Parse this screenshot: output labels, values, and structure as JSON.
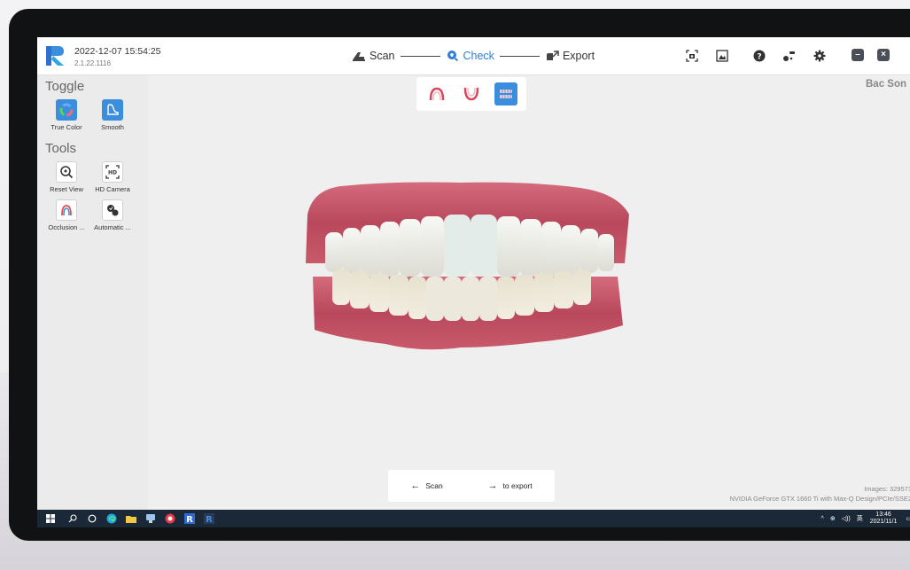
{
  "app": {
    "datetime": "2022-12-07 15:54:25",
    "version": "2.1.22.1116",
    "patient_name": "Bac Son"
  },
  "workflow": {
    "steps": [
      {
        "label": "Scan",
        "icon": "scanner-icon",
        "active": false
      },
      {
        "label": "Check",
        "icon": "magnifier-tooth-icon",
        "active": true
      },
      {
        "label": "Export",
        "icon": "export-icon",
        "active": false
      }
    ]
  },
  "toolbar_icons": [
    "screenshot-icon",
    "image-gallery-icon",
    "help-icon",
    "connect-device-icon",
    "settings-gear-icon"
  ],
  "sidebar": {
    "toggle_title": "Toggle",
    "toggle_items": [
      {
        "label": "True Color",
        "icon": "color-wheel-icon"
      },
      {
        "label": "Smooth",
        "icon": "smooth-icon"
      }
    ],
    "tools_title": "Tools",
    "tool_items": [
      {
        "label": "Reset View",
        "icon": "reset-view-icon"
      },
      {
        "label": "HD Camera",
        "icon": "hd-camera-icon"
      },
      {
        "label": "Occlusion ...",
        "icon": "occlusion-icon"
      },
      {
        "label": "Automatic ...",
        "icon": "automatic-icon"
      }
    ]
  },
  "view_toolbar": [
    {
      "icon": "upper-jaw-icon",
      "active": false
    },
    {
      "icon": "lower-jaw-icon",
      "active": false
    },
    {
      "icon": "both-jaws-icon",
      "active": true
    }
  ],
  "nav": {
    "back_label": "Scan",
    "forward_label": "to export"
  },
  "status": {
    "images": "Images: 329571",
    "gpu": "NVIDIA GeForce GTX 1660 Ti with Max-Q Design/PCIe/SSE2"
  },
  "taskbar": {
    "tray_lang": "英",
    "time": "13:46",
    "date": "2021/11/1"
  },
  "colors": {
    "accent": "#3b8ddd",
    "active_step": "#2f7ed8",
    "gum": "#c85a6a",
    "taskbar": "#1b2838"
  }
}
